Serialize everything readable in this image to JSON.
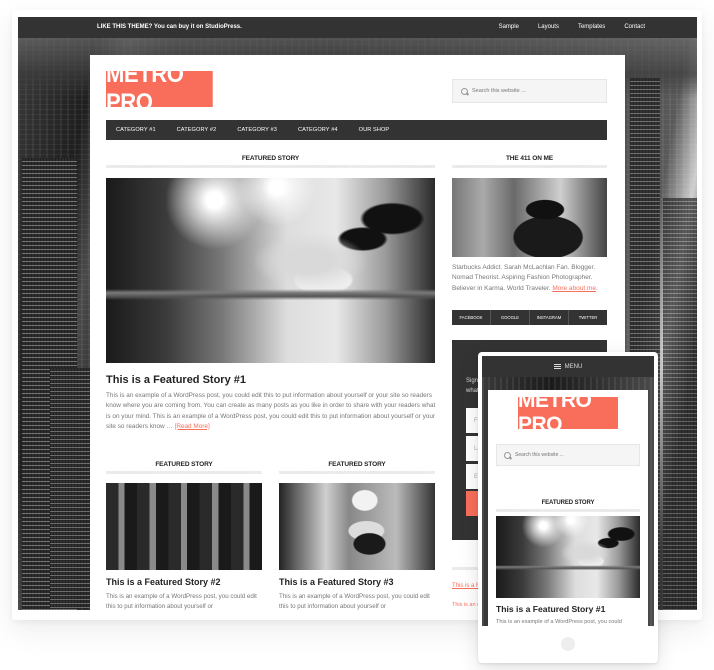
{
  "topbar": {
    "promo": "LIKE THIS THEME? You can buy it on StudioPress.",
    "links": [
      "Sample",
      "Layouts",
      "Templates",
      "Contact"
    ]
  },
  "header": {
    "logo": "METRO PRO",
    "search_placeholder": "Search this website ..."
  },
  "nav": {
    "items": [
      "CATEGORY #1",
      "CATEGORY #2",
      "CATEGORY #3",
      "CATEGORY #4",
      "OUR SHOP"
    ]
  },
  "main": {
    "featured_label": "FEATURED STORY",
    "featured": {
      "title": "This is a Featured Story #1",
      "excerpt": "This is an example of a WordPress post, you could edit this to put information about yourself or your site so readers know where you are coming from. You can create as many posts as you like in order to share with your readers what is on your mind. This is an example of a WordPress post, you could edit this to put information about yourself or your site so readers know …",
      "read_more": "[Read More]"
    },
    "secondary": [
      {
        "label": "FEATURED STORY",
        "title": "This is a Featured Story #2",
        "excerpt": "This is an example of a WordPress post, you could edit this to put information about yourself or"
      },
      {
        "label": "FEATURED STORY",
        "title": "This is a Featured Story #3",
        "excerpt": "This is an example of a WordPress post, you could edit this to put information about yourself or"
      }
    ]
  },
  "sidebar": {
    "about_title": "THE 411 ON ME",
    "bio": "Starbucks Addict. Sarah McLachlan Fan. Blogger. Nomad Theorist. Aspiring Fashion Photographer. Believer in Karma. World Traveler.",
    "more_link": "More about me",
    "social": [
      "FACEBOOK",
      "GOOGLE",
      "INSTAGRAM",
      "TWITTER"
    ],
    "newsletter": {
      "text": "Sign up to receive email updates and to hear what's going on with us!",
      "fields": [
        "First Name",
        "Last Name",
        "E-Mail Address"
      ]
    },
    "recent": [
      "This is a Featured Story",
      "This is an example of a WordPress post"
    ]
  },
  "phone": {
    "menu_label": "MENU",
    "logo": "METRO PRO",
    "search_placeholder": "Search this website ...",
    "featured_label": "FEATURED STORY",
    "featured_title": "This is a Featured Story #1",
    "featured_excerpt": "This is an example of a WordPress post, you could"
  },
  "colors": {
    "accent": "#f96e5b",
    "dark": "#333333"
  }
}
